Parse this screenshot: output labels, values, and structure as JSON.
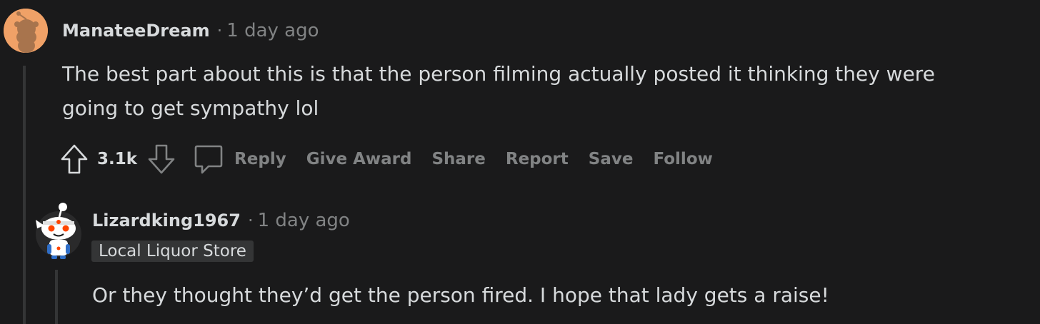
{
  "comments": [
    {
      "username": "ManateeDream",
      "separator": "·",
      "timestamp": "1 day ago",
      "body_lines": [
        "The best part about this is that the person filming actually posted it thinking they were",
        "going to get sympathy lol"
      ],
      "vote_count": "3.1k",
      "actions": [
        "Reply",
        "Give Award",
        "Share",
        "Report",
        "Save",
        "Follow"
      ],
      "avatar_icon": "snoo-avatar-orange-icon"
    },
    {
      "username": "Lizardking1967",
      "separator": "·",
      "timestamp": "1 day ago",
      "flair": "Local Liquor Store",
      "body_lines": [
        "Or they thought they’d get the person fired. I hope that lady gets a raise!"
      ],
      "avatar_icon": "snoo-avatar-dark-icon"
    }
  ],
  "colors": {
    "background": "#1a1a1b",
    "text": "#d7dadc",
    "muted": "#818384",
    "thread_line": "#343536",
    "avatar_orange": "#f0a167",
    "snoo_red": "#ff4500"
  }
}
